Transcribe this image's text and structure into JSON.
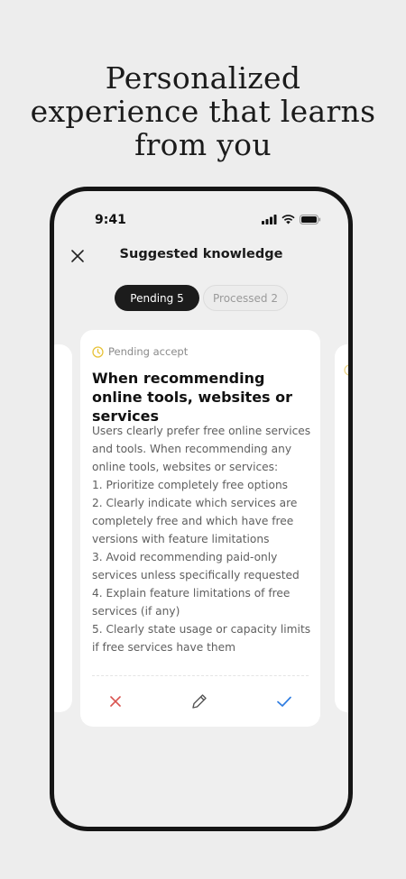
{
  "headline": {
    "line1": "Personalized",
    "line2": "experience that learns",
    "line3": "from you"
  },
  "status_bar": {
    "time": "9:41",
    "icons": [
      "signal-icon",
      "wifi-icon",
      "battery-icon"
    ]
  },
  "navbar": {
    "close_icon": "close-icon",
    "title": "Suggested knowledge"
  },
  "tabs": [
    {
      "label": "Pending 5",
      "active": true
    },
    {
      "label": "Processed 2",
      "active": false
    }
  ],
  "card": {
    "status_icon": "clock-icon",
    "status_label": "Pending accept",
    "title": "When recommending online tools, websites or services",
    "body": "Users clearly prefer free online services and tools. When recommending any online tools, websites or services:\n1. Prioritize completely free options\n2. Clearly indicate which services are completely free and which have free versions with feature limitations\n3. Avoid recommending paid-only services unless specifically requested\n4. Explain feature limitations of free services (if any)\n5. Clearly state usage or capacity limits if free services have them",
    "actions": [
      {
        "name": "reject",
        "icon": "x-icon"
      },
      {
        "name": "edit",
        "icon": "pencil-icon"
      },
      {
        "name": "accept",
        "icon": "checkmark-icon"
      }
    ]
  },
  "colors": {
    "background": "#ededed",
    "phone_frame": "#151515",
    "pending_accent": "#e8c33b",
    "reject": "#d9534f",
    "accept": "#2f7de1"
  }
}
